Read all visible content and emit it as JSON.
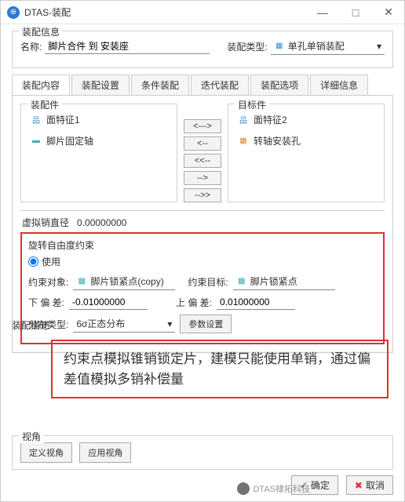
{
  "window": {
    "title": "DTAS-装配",
    "minimize": "—",
    "maximize": "□",
    "close": "✕"
  },
  "assembly_info": {
    "legend": "装配信息",
    "name_label": "名称:",
    "name_value": "脚片合件 到 安装座",
    "type_label": "装配类型:",
    "type_value": "单孔单销装配"
  },
  "tabs": [
    "装配内容",
    "装配设置",
    "条件装配",
    "迭代装配",
    "装配选项",
    "详细信息"
  ],
  "active_tab_index": 0,
  "assembly_parts": {
    "legend": "装配件",
    "items": [
      {
        "icon": "tree-blue",
        "label": "面特征1"
      },
      {
        "icon": "bar-teal",
        "label": "脚片固定轴"
      }
    ]
  },
  "target_parts": {
    "legend": "目标件",
    "items": [
      {
        "icon": "tree-blue",
        "label": "面特征2"
      },
      {
        "icon": "grid-orange",
        "label": "转轴安装孔"
      }
    ]
  },
  "move_buttons": [
    "<--->",
    "<--",
    "<<--",
    "-->",
    "-->>"
  ],
  "virtual_pin": {
    "label": "虚拟销直径",
    "value": "0.00000000"
  },
  "rotation": {
    "legend": "旋转自由度约束",
    "use_label": "使用",
    "obj_label": "约束对象:",
    "obj_value": "脚片锁紧点(copy)",
    "target_label": "约束目标:",
    "target_value": "脚片锁紧点",
    "lower_label": "下 偏 差:",
    "lower_value": "-0.01000000",
    "upper_label": "上 偏 差:",
    "upper_value": "0.01000000",
    "dist_label": "分布类型:",
    "dist_value": "6σ正态分布",
    "param_btn": "参数设置"
  },
  "note": "约束点模拟锥销锁定片，建模只能使用单销，通过偏差值模拟多销补偿量",
  "desc_label": "装配描述",
  "view": {
    "legend": "视角",
    "define": "定义视角",
    "apply": "应用视角"
  },
  "footer": {
    "ok": "确定",
    "cancel": "取消"
  },
  "watermark": "DTAS棣拓科技"
}
